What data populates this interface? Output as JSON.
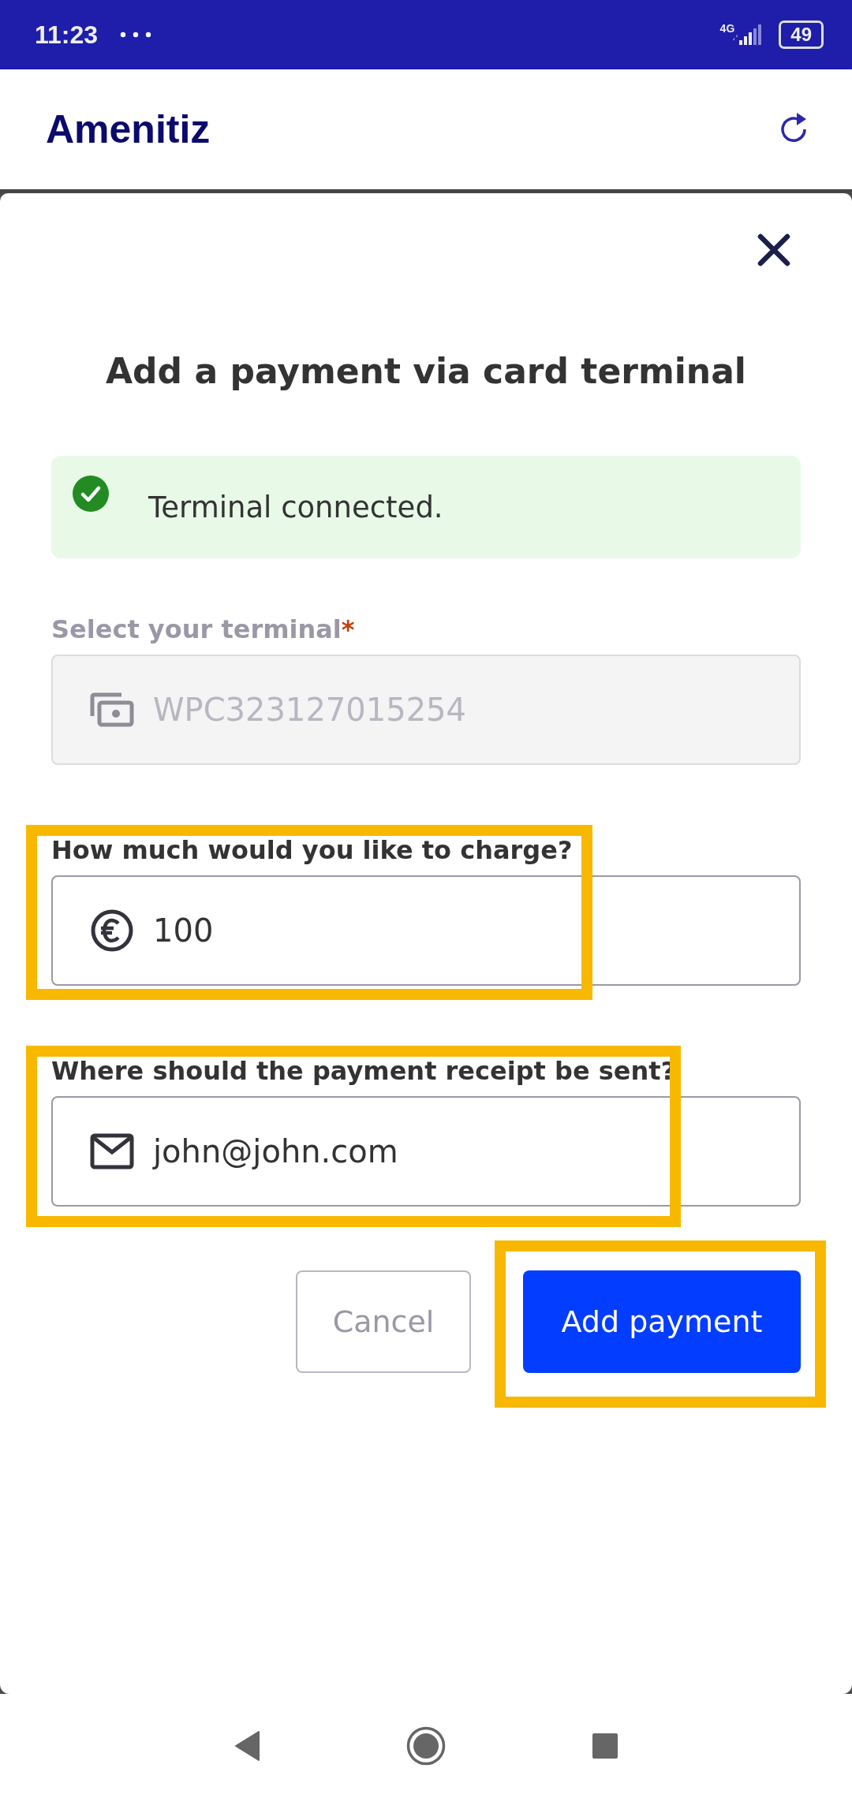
{
  "status_bar": {
    "time": "11:23",
    "network": "4G",
    "battery": "49"
  },
  "app_bar": {
    "title": "Amenitiz"
  },
  "dialog": {
    "title": "Add a payment via card terminal",
    "alert": {
      "kind": "success",
      "text": "Terminal connected."
    },
    "fields": [
      {
        "kind": "terminal",
        "label": "Select your terminal",
        "required_mark": "*",
        "value": "WPC323127015254",
        "disabled": true,
        "highlighted": false
      },
      {
        "kind": "amount",
        "label": "How much would you like to charge?",
        "value": "100",
        "disabled": false,
        "highlighted": true
      },
      {
        "kind": "email",
        "label": "Where should the payment receipt be sent?",
        "value": "john@john.com",
        "disabled": false,
        "highlighted": true
      }
    ],
    "buttons": [
      {
        "kind": "secondary",
        "label": "Cancel",
        "highlighted": false
      },
      {
        "kind": "primary",
        "label": "Add payment",
        "highlighted": true
      }
    ]
  }
}
